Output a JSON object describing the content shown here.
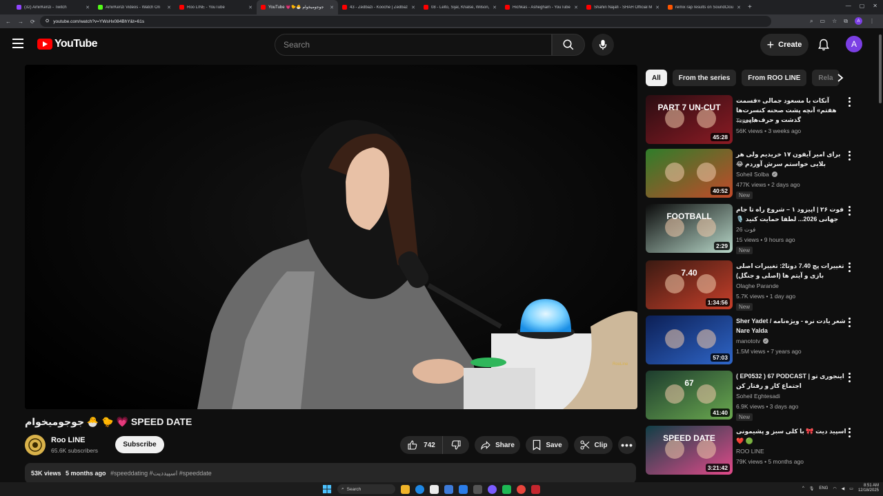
{
  "browser": {
    "tabs": [
      {
        "label": "(32) AmirKenzi - Twitch",
        "color": "#9146ff"
      },
      {
        "label": "AmirKenzi Videos - Watch On",
        "color": "#53fc18"
      },
      {
        "label": "Roo LINE - YouTube",
        "color": "#ff0000"
      },
      {
        "label": "YouTube 💗🐤🐣 جوجومیخوام",
        "color": "#ff0000",
        "active": true
      },
      {
        "label": "43 - Zedbazi - Kooche | Zedbaz",
        "color": "#ff0000"
      },
      {
        "label": "08 - Lelto, Sijal, Khalse, Wilson, S",
        "color": "#ff0000"
      },
      {
        "label": "Hichkas - Ashegham - YouTube",
        "color": "#ff0000"
      },
      {
        "label": "Shahin Najafi - SHAH Official M",
        "color": "#ff0000"
      },
      {
        "label": "remix rap results on SoundClou",
        "color": "#ff5500"
      }
    ],
    "url": "youtube.com/watch?v=YWsHx084BhY&t=61s",
    "profile_initial": "A"
  },
  "masthead": {
    "logo_text": "YouTube",
    "search_placeholder": "Search",
    "create_label": "Create",
    "avatar_initial": "A"
  },
  "video": {
    "title": "جوجومیخوام 🐣 🐤 💗 SPEED DATE",
    "channel": "Roo LINE",
    "subscribers": "65.6K subscribers",
    "subscribe_label": "Subscribe",
    "likes": "742",
    "share_label": "Share",
    "save_label": "Save",
    "clip_label": "Clip",
    "views": "53K views",
    "age": "5 months ago",
    "tags": "#speeddating #اسپیددیت #speeddate",
    "watermark": "RooLine"
  },
  "chips": [
    "All",
    "From the series",
    "From ROO LINE",
    "Rela"
  ],
  "recommendations": [
    {
      "title": "آنکات با مسعود جمالی «قسمت هفتم» آنچه پشت صحنه کنسرت‌ها گذشت و حرف‌هایی ...",
      "channel": "Tapesh",
      "verified": false,
      "meta": "56K views • 3 weeks ago",
      "duration": "45:28",
      "is_new": false,
      "thumb_text": "PART 7 UN-CUT",
      "thumb_colors": [
        "#2a0d12",
        "#8c1b24"
      ]
    },
    {
      "title": "برای امیر آیفون ۱۷ خریدیم ولی هر بلایی خواستم سرش آوردم 😂",
      "channel": "Soheil Solba",
      "verified": true,
      "meta": "477K views • 2 days ago",
      "duration": "40:52",
      "is_new": true,
      "new_label": "New",
      "thumb_text": "",
      "thumb_colors": [
        "#2f7d2a",
        "#c24a2a"
      ]
    },
    {
      "title": "فوت ۲۶ | اپیزود ۱ – شروع راه تا جام جهانی 2026... لطفا حمایت کنید 🎙️",
      "channel": "فوت 26",
      "verified": false,
      "meta": "15 views • 9 hours ago",
      "duration": "2:29",
      "is_new": true,
      "new_label": "New",
      "thumb_text": "FOOTBALL",
      "thumb_colors": [
        "#0b0b0b",
        "#b8d8c9"
      ]
    },
    {
      "title": "تغییرات پچ 7.40 دوتا2: تغییرات اصلی بازی و آیتم ها (اصلی و جنگل)",
      "channel": "Olaghe Parande",
      "verified": false,
      "meta": "5.7K views • 1 day ago",
      "duration": "1:34:56",
      "is_new": true,
      "new_label": "New",
      "thumb_text": "7.40",
      "thumb_colors": [
        "#3a1a12",
        "#c73f2a"
      ]
    },
    {
      "title": "Sher Yadet / شعر یادت نره - ویژه‌نامه Nare Yalda",
      "channel": "manototv",
      "verified": true,
      "meta": "1.5M views • 7 years ago",
      "duration": "57:03",
      "is_new": false,
      "thumb_text": "",
      "thumb_colors": [
        "#0c1f55",
        "#2f66c8"
      ]
    },
    {
      "title": "( EP0532 ) 67 PODCAST | اینجوری تو اجتماع کار و رفتار کن",
      "channel": "Soheil Eghtesadi",
      "verified": false,
      "meta": "6.9K views • 3 days ago",
      "duration": "41:40",
      "is_new": true,
      "new_label": "New",
      "thumb_text": "67",
      "thumb_colors": [
        "#1d3c2e",
        "#6aa84f"
      ]
    },
    {
      "title": "اسپید دیت 🎀 با کلی سبز و پشیمونی 🟢 ❤️",
      "channel": "ROO LINE",
      "verified": false,
      "meta": "79K views • 5 months ago",
      "duration": "3:21:42",
      "is_new": false,
      "thumb_text": "SPEED DATE",
      "thumb_colors": [
        "#103f46",
        "#e24a8a"
      ]
    }
  ],
  "taskbar": {
    "search_label": "Search",
    "lang": "ENG",
    "time": "8:51 AM",
    "date": "12/18/2025"
  }
}
